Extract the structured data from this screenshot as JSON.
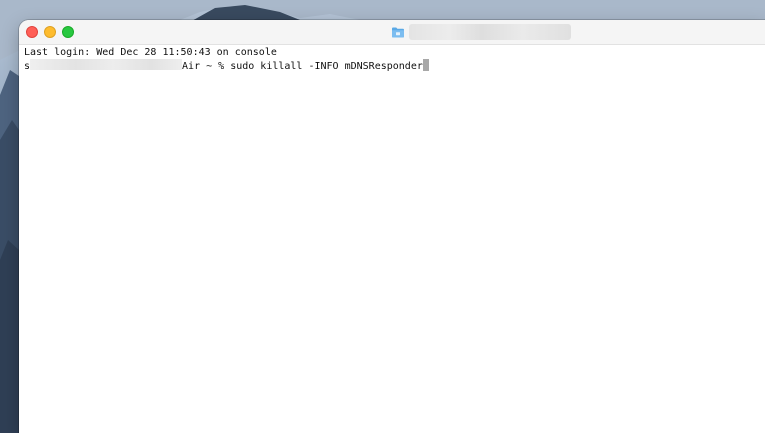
{
  "window": {
    "title": "",
    "folder_icon": "folder-icon"
  },
  "terminal": {
    "last_login": "Last login: Wed Dec 28 11:50:43 on console",
    "prompt_prefix": "s",
    "prompt_suffix": "Air ~ % ",
    "command": "sudo killall -INFO mDNSResponder"
  },
  "colors": {
    "close": "#ff5f57",
    "minimize": "#febc2e",
    "zoom": "#28c840",
    "folder": "#5aa9e6"
  }
}
